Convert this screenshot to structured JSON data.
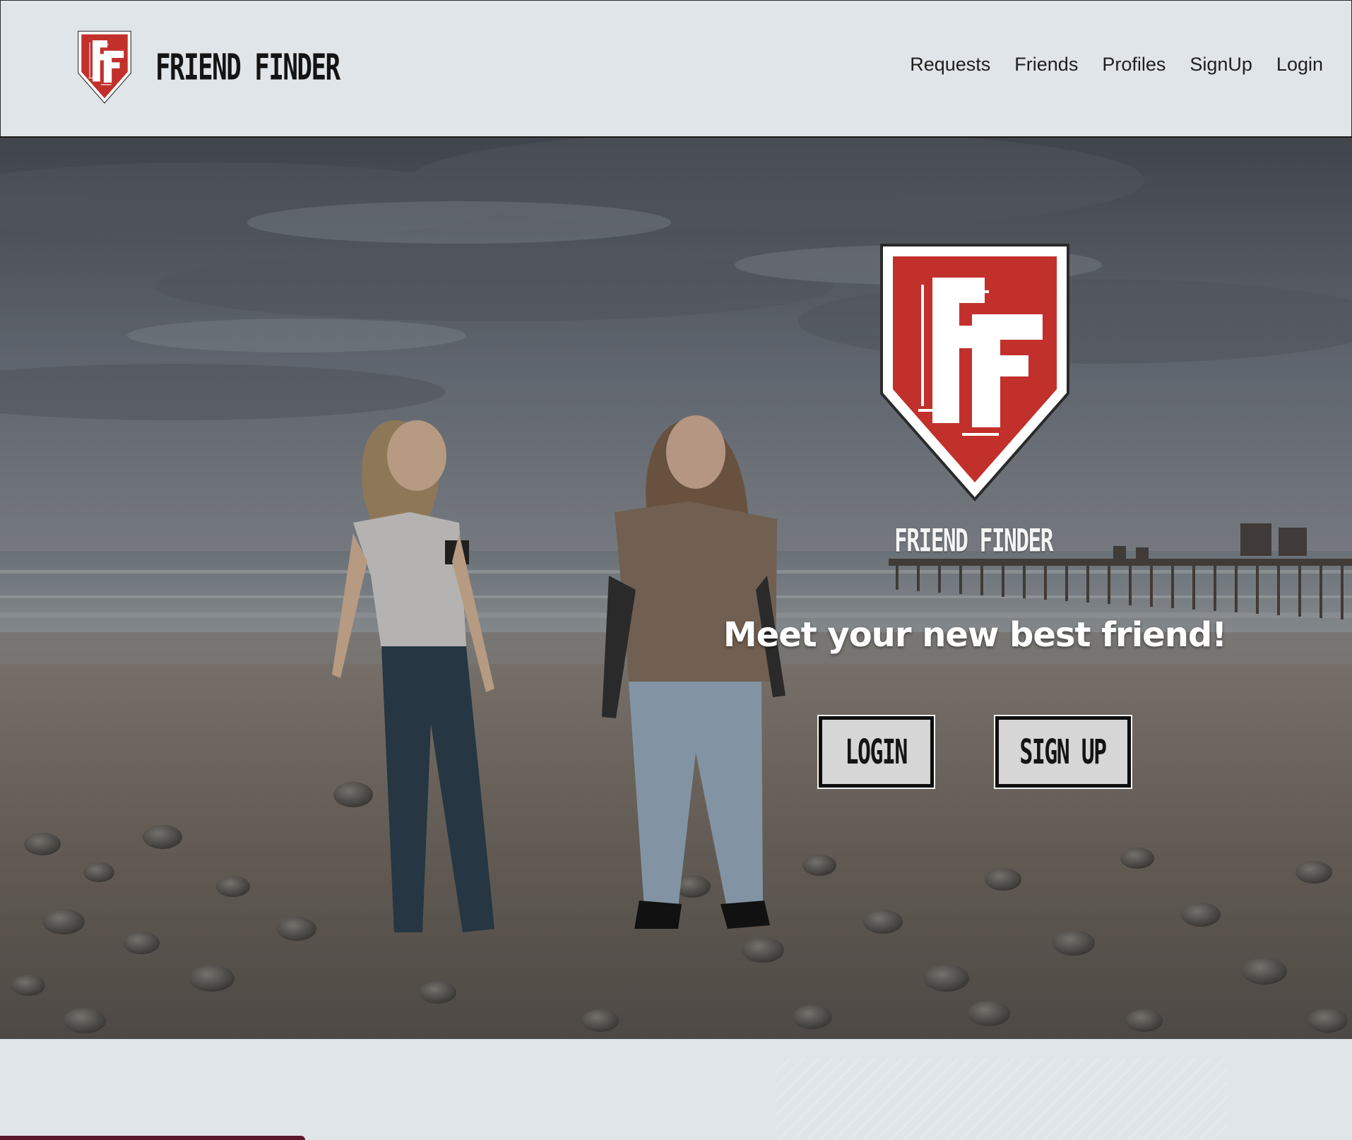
{
  "header": {
    "brand_name": "FRIEND FINDER",
    "logo_icon": "ff-shield-logo-icon",
    "nav": [
      {
        "label": "Requests"
      },
      {
        "label": "Friends"
      },
      {
        "label": "Profiles"
      },
      {
        "label": "SignUp"
      },
      {
        "label": "Login"
      }
    ]
  },
  "hero": {
    "logo_icon": "ff-shield-logo-icon",
    "brand_name": "FRIEND FINDER",
    "tagline": "Meet your new best friend!",
    "login_label": "LOGIN",
    "signup_label": "SIGN UP"
  },
  "colors": {
    "page_background": "#e0e5ea",
    "brand_red": "#c2302b",
    "button_background": "#d6d6d6",
    "footer_accent": "#5a1a2c"
  }
}
